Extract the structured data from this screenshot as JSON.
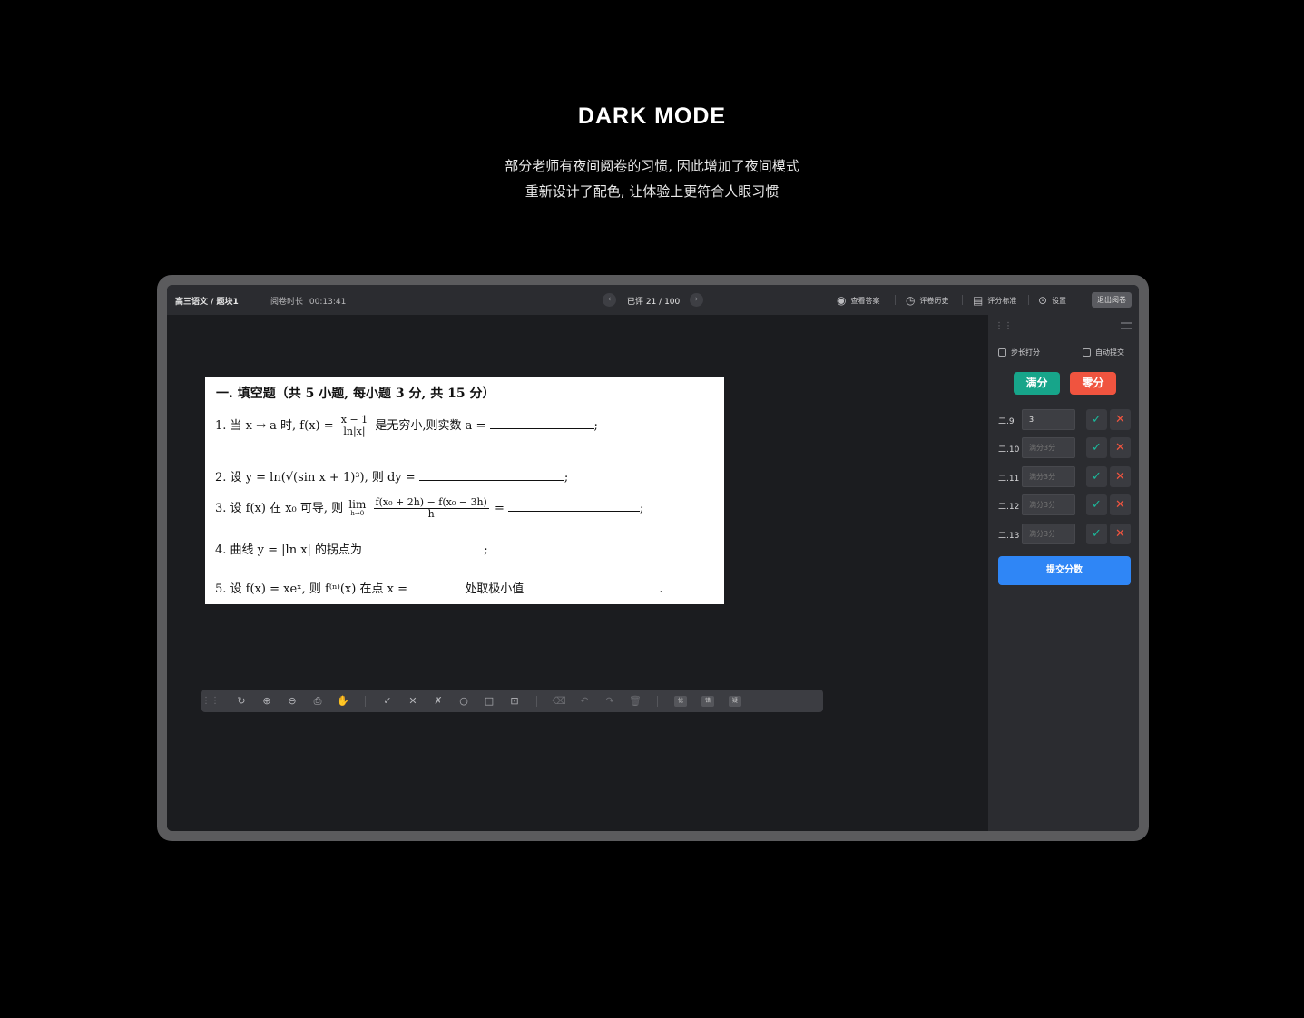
{
  "hero": {
    "title": "DARK MODE",
    "subtitle_line1": "部分老师有夜间阅卷的习惯, 因此增加了夜间模式",
    "subtitle_line2": "重新设计了配色, 让体验上更符合人眼习惯"
  },
  "topbar": {
    "breadcrumb": "高三语文 / 题块1",
    "timer_label": "阅卷时长",
    "timer_value": "00:13:41",
    "prev_icon": "‹",
    "next_icon": "›",
    "progress": "已评 21  / 100",
    "actions": [
      {
        "icon": "eye-icon",
        "glyph": "◉",
        "label": "查看答案"
      },
      {
        "icon": "clock-icon",
        "glyph": "◷",
        "label": "评卷历史"
      },
      {
        "icon": "document-icon",
        "glyph": "▤",
        "label": "评分标准"
      },
      {
        "icon": "gear-icon",
        "glyph": "⊙",
        "label": "设置"
      }
    ],
    "exit_label": "退出阅卷"
  },
  "paper": {
    "heading": "一. 填空题（共 5 小题, 每小题 3 分, 共 15 分）",
    "q1_prefix": "1.  当 x → a 时, f(x) =",
    "q1_num": "x − 1",
    "q1_den": "ln|x|",
    "q1_suffix": "是无穷小,则实数 a =",
    "q2": "2.  设 y = ln(√(sin x + 1)³),  则 dy =",
    "q3_prefix": "3.  设 f(x) 在 x₀ 可导,  则",
    "q3_lim": "lim",
    "q3_lim_sub": "h→0",
    "q3_num": "f(x₀ + 2h) − f(x₀ − 3h)",
    "q3_den": "h",
    "q3_eq": "=",
    "q4": "4.  曲线 y = |ln x| 的拐点为",
    "q5_a": "5.  设 f(x) = xeˣ,  则 f⁽ⁿ⁾(x) 在点 x =",
    "q5_b": "处取极小值",
    "semicolon": ";",
    "period": "."
  },
  "tools": {
    "group1": [
      "↻",
      "⊕",
      "⊖",
      "⎙",
      "✋"
    ],
    "group2": [
      "✓",
      "✕",
      "✗",
      "○",
      "□",
      "⊡"
    ],
    "group3": [
      "⌫",
      "↶",
      "↷",
      "🗑"
    ],
    "group4": [
      "优",
      "错",
      "疑"
    ]
  },
  "sidebar": {
    "step_score_label": "步长打分",
    "auto_submit_label": "自动提交",
    "full_label": "满分",
    "zero_label": "零分",
    "rows": [
      {
        "label": "二.9",
        "value": "3",
        "placeholder": ""
      },
      {
        "label": "二.10",
        "value": "",
        "placeholder": "满分3分"
      },
      {
        "label": "二.11",
        "value": "",
        "placeholder": "满分3分"
      },
      {
        "label": "二.12",
        "value": "",
        "placeholder": "满分3分"
      },
      {
        "label": "二.13",
        "value": "",
        "placeholder": "满分3分"
      }
    ],
    "ok_glyph": "✓",
    "no_glyph": "✕",
    "submit_label": "提交分数"
  },
  "colors": {
    "accent_blue": "#2f86f6",
    "full_green": "#17a58a",
    "zero_red": "#f0543f"
  }
}
